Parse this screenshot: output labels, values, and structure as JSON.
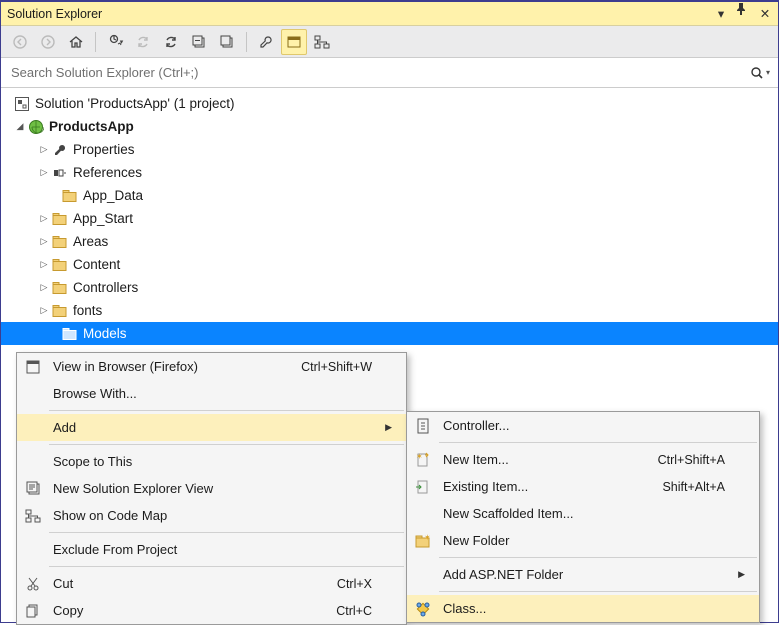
{
  "titlebar": {
    "title": "Solution Explorer"
  },
  "search": {
    "placeholder": "Search Solution Explorer (Ctrl+;)"
  },
  "tree": {
    "solution": "Solution 'ProductsApp' (1 project)",
    "project": "ProductsApp",
    "items": {
      "properties": "Properties",
      "references": "References",
      "appdata": "App_Data",
      "appstart": "App_Start",
      "areas": "Areas",
      "content": "Content",
      "controllers": "Controllers",
      "fonts": "fonts",
      "models": "Models"
    }
  },
  "ctx1": {
    "viewBrowser": "View in Browser (Firefox)",
    "viewBrowserShort": "Ctrl+Shift+W",
    "browseWith": "Browse With...",
    "add": "Add",
    "scope": "Scope to This",
    "newView": "New Solution Explorer View",
    "codeMap": "Show on Code Map",
    "exclude": "Exclude From Project",
    "cut": "Cut",
    "cutShort": "Ctrl+X",
    "copy": "Copy",
    "copyShort": "Ctrl+C"
  },
  "ctx2": {
    "controller": "Controller...",
    "newItem": "New Item...",
    "newItemShort": "Ctrl+Shift+A",
    "existingItem": "Existing Item...",
    "existingItemShort": "Shift+Alt+A",
    "scaffolded": "New Scaffolded Item...",
    "newFolder": "New Folder",
    "aspFolder": "Add ASP.NET Folder",
    "class": "Class..."
  }
}
